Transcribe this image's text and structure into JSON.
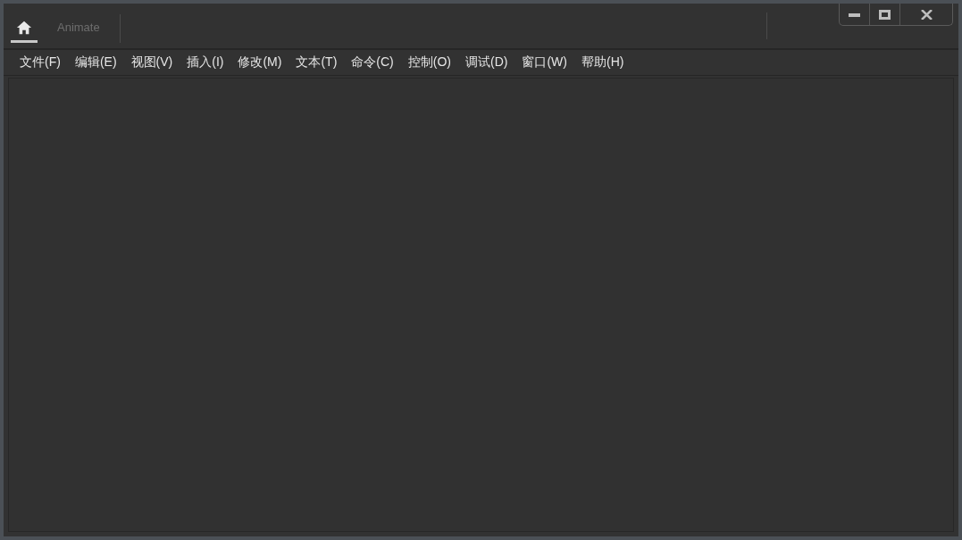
{
  "tabs": [
    {
      "kind": "home",
      "selected": true
    },
    {
      "kind": "text",
      "label": "Animate",
      "selected": false
    }
  ],
  "menu": [
    "文件(F)",
    "编辑(E)",
    "视图(V)",
    "插入(I)",
    "修改(M)",
    "文本(T)",
    "命令(C)",
    "控制(O)",
    "调试(D)",
    "窗口(W)",
    "帮助(H)"
  ]
}
